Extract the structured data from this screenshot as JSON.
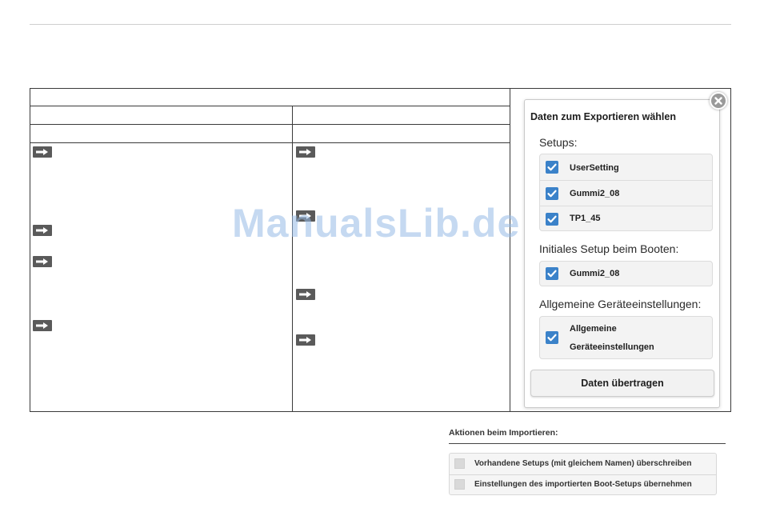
{
  "watermark": "ManualsLib.de",
  "export_dialog": {
    "title": "Daten zum Exportieren wählen",
    "setups_label": "Setups:",
    "setups": [
      {
        "label": "UserSetting",
        "checked": true
      },
      {
        "label": "Gummi2_08",
        "checked": true
      },
      {
        "label": "TP1_45",
        "checked": true
      }
    ],
    "boot_label": "Initiales Setup beim Booten:",
    "boot_setup": {
      "label": "Gummi2_08",
      "checked": true
    },
    "general_label": "Allgemeine Geräteeinstellungen:",
    "general_item": {
      "line1": "Allgemeine",
      "line2": "Geräteeinstellungen",
      "checked": true
    },
    "transfer_button": "Daten übertragen",
    "checkbox_color": "#3b82c9"
  },
  "import_panel": {
    "title": "Aktionen beim Importieren:",
    "options": [
      {
        "label": "Vorhandene Setups (mit gleichem Namen) überschreiben",
        "checked": false
      },
      {
        "label": "Einstellungen des importierten Boot-Setups übernehmen",
        "checked": false
      }
    ]
  }
}
